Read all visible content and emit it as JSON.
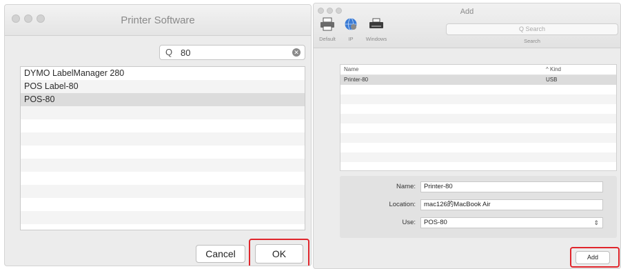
{
  "left_dialog": {
    "title": "Printer Software",
    "search_value": "80",
    "items": [
      {
        "label": "DYMO LabelManager 280"
      },
      {
        "label": "POS Label-80"
      },
      {
        "label": "POS-80"
      }
    ],
    "selected_index": 2,
    "cancel_label": "Cancel",
    "ok_label": "OK"
  },
  "right_dialog": {
    "title": "Add",
    "toolbar": [
      {
        "label": "Default",
        "icon": "printer-icon"
      },
      {
        "label": "IP",
        "icon": "globe-icon"
      },
      {
        "label": "Windows",
        "icon": "windows-printer-icon"
      }
    ],
    "search_placeholder": "Search",
    "search_label": "Search",
    "columns": {
      "name": "Name",
      "kind": "Kind"
    },
    "printers": [
      {
        "name": "Printer-80",
        "kind": "USB"
      }
    ],
    "form": {
      "name_label": "Name:",
      "name_value": "Printer-80",
      "location_label": "Location:",
      "location_value": "mac126的MacBook Air",
      "use_label": "Use:",
      "use_value": "POS-80"
    },
    "add_label": "Add"
  },
  "colors": {
    "highlight_box": "#e0252b",
    "selection": "#dcdcdc"
  }
}
